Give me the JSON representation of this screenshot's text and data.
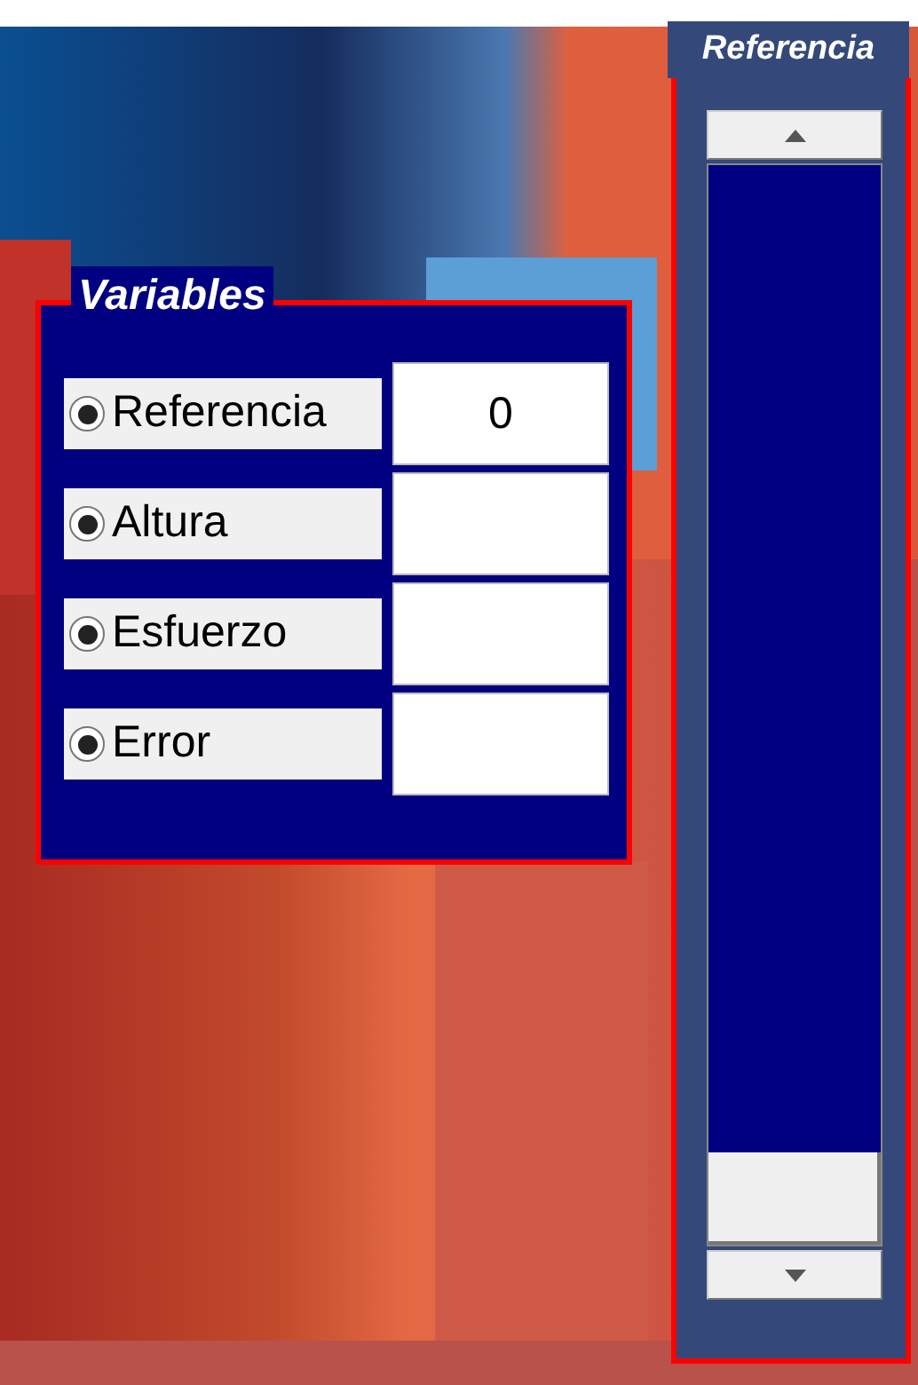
{
  "variables_panel": {
    "title": "Variables",
    "rows": [
      {
        "label": "Referencia",
        "checked": true,
        "value": "0"
      },
      {
        "label": "Altura",
        "checked": true
      },
      {
        "label": "Esfuerzo",
        "checked": true
      },
      {
        "label": "Error",
        "checked": true
      }
    ]
  },
  "reference_panel": {
    "title": "Referencia",
    "slider": {
      "level": 0
    }
  }
}
